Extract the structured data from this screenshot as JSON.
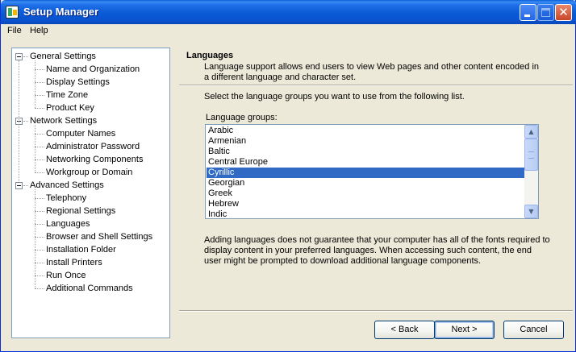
{
  "window": {
    "title": "Setup Manager"
  },
  "menu": [
    "File",
    "Help"
  ],
  "tree": {
    "groups": [
      {
        "label": "General Settings",
        "children": [
          "Name and Organization",
          "Display Settings",
          "Time Zone",
          "Product Key"
        ]
      },
      {
        "label": "Network Settings",
        "children": [
          "Computer Names",
          "Administrator Password",
          "Networking Components",
          "Workgroup or Domain"
        ]
      },
      {
        "label": "Advanced Settings",
        "children": [
          "Telephony",
          "Regional Settings",
          "Languages",
          "Browser and Shell Settings",
          "Installation Folder",
          "Install Printers",
          "Run Once",
          "Additional Commands"
        ]
      }
    ],
    "selected": "Languages"
  },
  "page": {
    "title": "Languages",
    "description": "Language support allows end users to view Web pages and other content encoded in a different language and character set.",
    "instructions": "Select the language groups you want to use from the following list.",
    "list_label": "Language groups:",
    "languages": [
      "Arabic",
      "Armenian",
      "Baltic",
      "Central Europe",
      "Cyrillic",
      "Georgian",
      "Greek",
      "Hebrew",
      "Indic"
    ],
    "selected_language": "Cyrillic",
    "note": "Adding languages does not guarantee that your computer has all of the fonts required to display content in your preferred languages. When accessing such content, the end user might be prompted to download additional language components."
  },
  "buttons": {
    "back": "< Back",
    "next": "Next >",
    "cancel": "Cancel"
  },
  "colors": {
    "titlebar": "#0a53cf",
    "selection": "#316ac5",
    "window_bg": "#ece9d8"
  }
}
